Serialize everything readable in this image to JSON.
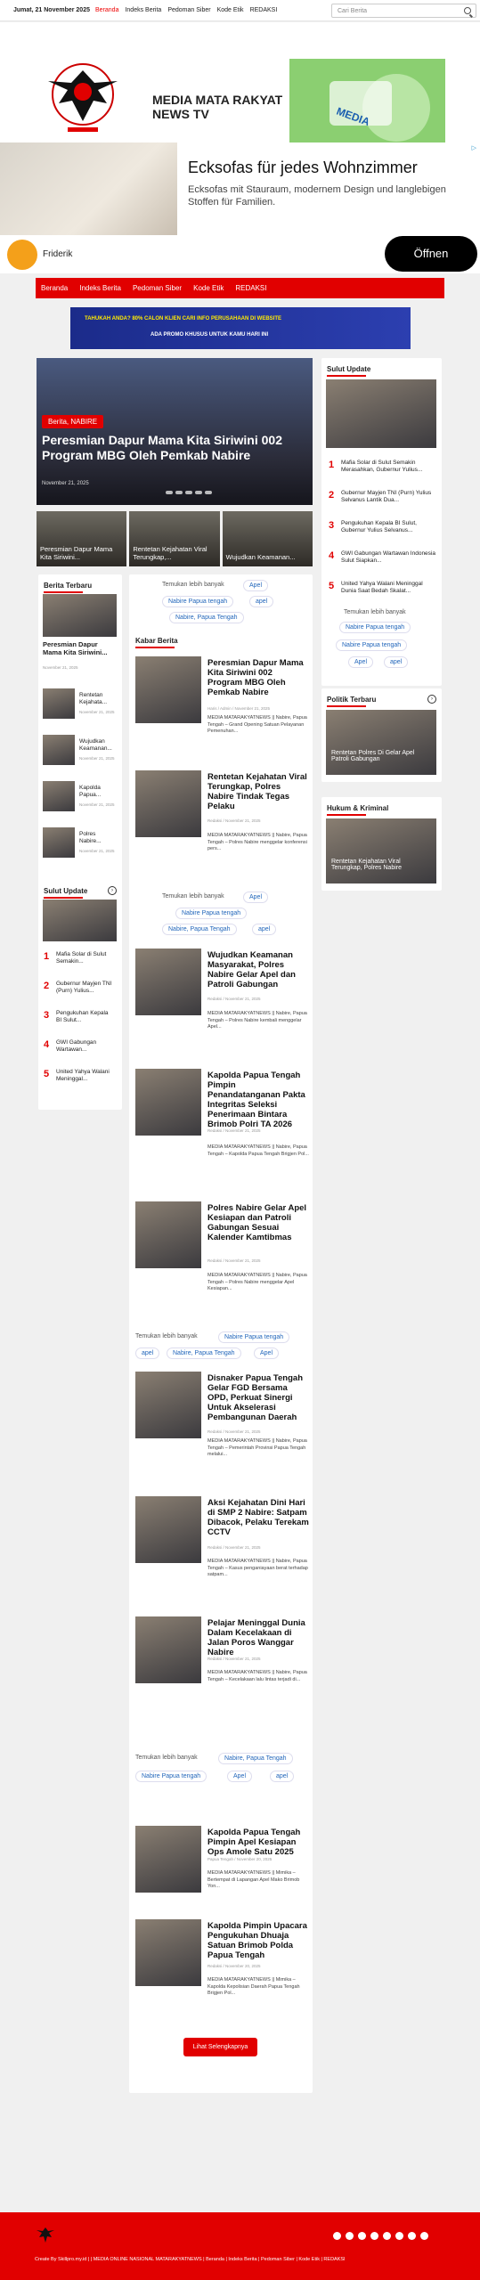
{
  "topbar": {
    "date": "Jumat, 21 November 2025",
    "nav": [
      "Beranda",
      "Indeks Berita",
      "Pedoman Siber",
      "Kode Etik",
      "REDAKSI"
    ],
    "search_placeholder": "Cari Berita"
  },
  "header": {
    "site_name_line1": "MEDIA MATA RAKYAT",
    "site_name_line2": "NEWS TV",
    "ad_text": "MEDIA"
  },
  "ad_banner": {
    "title": "Ecksofas für jedes Wohnzimmer",
    "description": "Ecksofas mit Stauraum, modernem Design und langlebigen Stoffen für Familien."
  },
  "ad_app": {
    "name": "Friderik",
    "button": "Öffnen"
  },
  "main_nav": [
    "Beranda",
    "Indeks Berita",
    "Pedoman Siber",
    "Kode Etik",
    "REDAKSI"
  ],
  "promo_banner": {
    "line1": "TAHUKAH ANDA? 80% CALON KLIEN CARI INFO PERUSAHAAN DI WEBSITE",
    "line2": "ADA PROMO KHUSUS UNTUK KAMU HARI INI"
  },
  "hero": {
    "category": "Berita, NABIRE",
    "title": "Peresmian Dapur Mama Kita Siriwini 002 Program MBG Oleh Pemkab Nabire",
    "date": "November 21, 2025"
  },
  "thumb_row": [
    "Peresmian Dapur Mama Kita Siriwini...",
    "Rentetan Kejahatan Viral Terungkap,...",
    "Wujudkan Keamanan..."
  ],
  "sidebar_left": {
    "berita_terbaru_title": "Berita Terbaru",
    "featured": "Peresmian Dapur Mama Kita Siriwini...",
    "featured_date": "November 21, 2025",
    "items": [
      {
        "title": "Rentetan Kejahata...",
        "date": "November 21, 2025"
      },
      {
        "title": "Wujudkan Keamanan...",
        "date": "November 21, 2025"
      },
      {
        "title": "Kapolda Papua...",
        "date": "November 21, 2025"
      },
      {
        "title": "Polres Nabire...",
        "date": "November 21, 2025"
      }
    ],
    "sulut_title": "Sulut Update",
    "sulut_items": [
      "Mafia Solar di Sulut Semakin...",
      "Gubernur Mayjen TNI (Purn) Yulius...",
      "Pengukuhan Kepala BI Sulut...",
      "GWI Gabungan Wartawan...",
      "United Yahya Walani Meninggal..."
    ]
  },
  "sidebar_right": {
    "sulut_title": "Sulut Update",
    "sulut_items": [
      "Mafia Solar di Sulut Semakin Merasahkan, Gubernur Yulius...",
      "Gubernur Mayjen TNI (Purn) Yulius Selvanus Lantik Dua...",
      "Pengukuhan Kepala BI Sulut, Gubernur Yulius Selvanus...",
      "GWI Gabungan Wartawan Indonesia Sulut Siapkan...",
      "United Yahya Walani Meninggal Dunia Saat Bedah Skalat..."
    ],
    "more_label": "Temukan lebih banyak",
    "tags": [
      "Nabire Papua tengah",
      "Apel",
      "apel"
    ],
    "politik_title": "Politik Terbaru",
    "politik_caption": "Rentetan Polres Di Gelar Apel Patroli Gabungan",
    "hukum_title": "Hukum & Kriminal",
    "hukum_caption": "Rentetan Kejahatan Viral Terungkap, Polres Nabire"
  },
  "main_col": {
    "more_label": "Temukan lebih banyak",
    "tags_1": [
      "Apel",
      "Nabire Papua tengah",
      "apel",
      "Nabire, Papua Tengah"
    ],
    "section_title": "Kabar Berita",
    "tags_2": [
      "Apel",
      "Nabire Papua tengah",
      "Nabire, Papua Tengah",
      "apel"
    ],
    "tags_3": [
      "Nabire Papua tengah",
      "apel",
      "Nabire, Papua Tengah",
      "Apel"
    ],
    "tags_4": [
      "Nabire, Papua Tengah",
      "Nabire Papua tengah",
      "Apel",
      "apel"
    ],
    "load_more": "Lihat Selengkapnya",
    "posts": [
      {
        "title": "Peresmian Dapur Mama Kita Siriwini 002 Program MBG Oleh Pemkab Nabire",
        "meta": "Haris / Admin / November 21, 2025",
        "excerpt": "MEDIA MATARAKYATNEWS || Nabire, Papua Tengah – Grand Opening Satuan Pelayanan Pemenuhan..."
      },
      {
        "title": "Rentetan Kejahatan Viral Terungkap, Polres Nabire Tindak Tegas Pelaku",
        "meta": "Redaksi / November 21, 2025",
        "excerpt": "MEDIA MATARAKYATNEWS || Nabire, Papua Tengah – Polres Nabire menggelar konferensi pers..."
      },
      {
        "title": "Wujudkan Keamanan Masyarakat, Polres Nabire Gelar Apel dan Patroli Gabungan",
        "meta": "Redaksi / November 21, 2025",
        "excerpt": "MEDIA MATARAKYATNEWS || Nabire, Papua Tengah – Polres Nabire kembali menggelar Apel..."
      },
      {
        "title": "Kapolda Papua Tengah Pimpin Penandatanganan Pakta Integritas Seleksi Penerimaan Bintara Brimob Polri TA 2026",
        "meta": "Redaksi / November 21, 2025",
        "excerpt": "MEDIA MATARAKYATNEWS || Nabire, Papua Tengah – Kapolda Papua Tengah Brigjen Pol..."
      },
      {
        "title": "Polres Nabire Gelar Apel Kesiapan dan Patroli Gabungan Sesuai Kalender Kamtibmas",
        "meta": "Redaksi / November 21, 2025",
        "excerpt": "MEDIA MATARAKYATNEWS || Nabire, Papua Tengah – Polres Nabire menggelar Apel Kesiapan..."
      },
      {
        "title": "Disnaker Papua Tengah Gelar FGD Bersama OPD, Perkuat Sinergi Untuk Akselerasi Pembangunan Daerah",
        "meta": "Redaksi / November 21, 2025",
        "excerpt": "MEDIA MATARAKYATNEWS || Nabire, Papua Tengah – Pemerintah Provinsi Papua Tengah melalui..."
      },
      {
        "title": "Aksi Kejahatan Dini Hari di SMP 2 Nabire: Satpam Dibacok, Pelaku Terekam CCTV",
        "meta": "Redaksi / November 21, 2025",
        "excerpt": "MEDIA MATARAKYATNEWS || Nabire, Papua Tengah – Kasus penganiayaan berat terhadap satpam..."
      },
      {
        "title": "Pelajar Meninggal Dunia Dalam Kecelakaan di Jalan Poros Wanggar Nabire",
        "meta": "Redaksi / November 21, 2025",
        "excerpt": "MEDIA MATARAKYATNEWS || Nabire, Papua Tengah – Kecelakaan lalu lintas terjadi di..."
      },
      {
        "title": "Kapolda Papua Tengah Pimpin Apel Kesiapan Ops Amole Satu 2025",
        "meta": "Papua Tengah / November 20, 2025",
        "excerpt": "MEDIA MATARAKYATNEWS || Mimika – Bertempat di Lapangan Apel Mako Brimob Yon..."
      },
      {
        "title": "Kapolda Pimpin Upacara Pengukuhan Dhuaja Satuan Brimob Polda Papua Tengah",
        "meta": "Redaksi / November 20, 2025",
        "excerpt": "MEDIA MATARAKYATNEWS || Mimika – Kapolda Kepolisian Daerah Papua Tengah Brigjen Pol..."
      }
    ]
  },
  "footer": {
    "copyright": "Create By Skillpro.my.id | | MEDIA ONLINE NASIONAL MATARAKYATNEWS | Beranda | Indeks Berita | Pedoman Siber | Kode Etik | REDAKSI",
    "social_icons": [
      "facebook-icon",
      "x-icon",
      "youtube-icon",
      "instagram-icon",
      "email-icon",
      "tiktok-icon",
      "rss-icon"
    ]
  }
}
